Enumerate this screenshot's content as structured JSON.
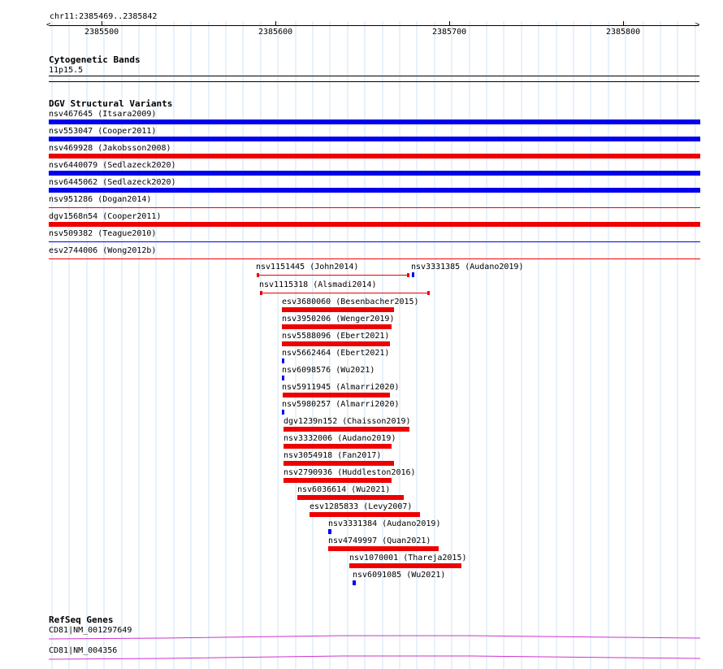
{
  "region": "chr11:2385469..2385842",
  "ruler": {
    "tick_labels": [
      "2385500",
      "2385600",
      "2385700",
      "2385800"
    ]
  },
  "cytoband": {
    "title": "Cytogenetic Bands",
    "band": "11p15.5"
  },
  "dgv": {
    "title": "DGV Structural Variants",
    "full_width": [
      {
        "label": "nsv467645 (Itsara2009)",
        "color": "#0000ee",
        "style": "thick"
      },
      {
        "label": "nsv553047 (Cooper2011)",
        "color": "#0000ee",
        "style": "thick"
      },
      {
        "label": "nsv469928 (Jakobsson2008)",
        "color": "#ee0000",
        "style": "thick"
      },
      {
        "label": "nsv6440079 (Sedlazeck2020)",
        "color": "#0000ee",
        "style": "thick"
      },
      {
        "label": "nsv6445062 (Sedlazeck2020)",
        "color": "#0000ee",
        "style": "thick"
      },
      {
        "label": "nsv951286 (Dogan2014)",
        "color": "#ee0000",
        "style": "thin"
      },
      {
        "label": "dgv1568n54 (Cooper2011)",
        "color": "#ee0000",
        "style": "thick"
      },
      {
        "label": "nsv509382 (Teague2010)",
        "color": "#0000ee",
        "style": "thin"
      },
      {
        "label": "esv2744006 (Wong2012b)",
        "color": "#ee0000",
        "style": "thin"
      }
    ],
    "local": [
      {
        "label": "nsv1151445 (John2014)",
        "color": "#ee0000",
        "style": "thin"
      },
      {
        "label": "nsv3331385 (Audano2019)",
        "color": "#0000ee",
        "style": "small"
      },
      {
        "label": "nsv1115318 (Alsmadi2014)",
        "color": "#ee0000",
        "style": "thin"
      },
      {
        "label": "esv3680060 (Besenbacher2015)",
        "color": "#ee0000",
        "style": "thick"
      },
      {
        "label": "nsv3950206 (Wenger2019)",
        "color": "#ee0000",
        "style": "thick"
      },
      {
        "label": "nsv5588096 (Ebert2021)",
        "color": "#ee0000",
        "style": "thick"
      },
      {
        "label": "nsv5662464 (Ebert2021)",
        "color": "#0000ee",
        "style": "small"
      },
      {
        "label": "nsv6098576 (Wu2021)",
        "color": "#0000ee",
        "style": "small"
      },
      {
        "label": "nsv5911945 (Almarri2020)",
        "color": "#ee0000",
        "style": "thick"
      },
      {
        "label": "nsv5980257 (Almarri2020)",
        "color": "#0000ee",
        "style": "small"
      },
      {
        "label": "dgv1239n152 (Chaisson2019)",
        "color": "#ee0000",
        "style": "thick"
      },
      {
        "label": "nsv3332006 (Audano2019)",
        "color": "#ee0000",
        "style": "thick"
      },
      {
        "label": "nsv3054918 (Fan2017)",
        "color": "#ee0000",
        "style": "thick"
      },
      {
        "label": "nsv2790936 (Huddleston2016)",
        "color": "#ee0000",
        "style": "thick"
      },
      {
        "label": "nsv6036614 (Wu2021)",
        "color": "#ee0000",
        "style": "thick"
      },
      {
        "label": "esv1285833 (Levy2007)",
        "color": "#ee0000",
        "style": "thick"
      },
      {
        "label": "nsv3331384 (Audano2019)",
        "color": "#0000ee",
        "style": "small"
      },
      {
        "label": "nsv4749997 (Quan2021)",
        "color": "#ee0000",
        "style": "thick"
      },
      {
        "label": "nsv1070001 (Thareja2015)",
        "color": "#ee0000",
        "style": "thick"
      },
      {
        "label": "nsv6091085 (Wu2021)",
        "color": "#0000ee",
        "style": "small"
      }
    ]
  },
  "refseq": {
    "title": "RefSeq Genes",
    "genes": [
      {
        "label": "CD81|NM_001297649",
        "color": "#cc33cc"
      },
      {
        "label": "CD81|NM_004356",
        "color": "#cc33cc"
      }
    ]
  }
}
